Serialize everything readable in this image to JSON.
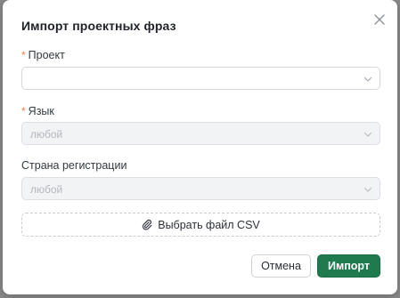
{
  "dialog": {
    "title": "Импорт проектных фраз",
    "close_icon": "close-icon"
  },
  "fields": {
    "project": {
      "label": "Проект",
      "required": true,
      "value": "",
      "icon": "chevron-down-icon"
    },
    "language": {
      "label": "Язык",
      "required": true,
      "value": "любой",
      "disabled": true,
      "icon": "chevron-down-icon"
    },
    "country": {
      "label": "Страна регистрации",
      "required": false,
      "value": "любой",
      "disabled": true,
      "icon": "chevron-down-icon"
    }
  },
  "file_upload": {
    "label": "Выбрать файл CSV",
    "icon": "paperclip-icon"
  },
  "actions": {
    "cancel_label": "Отмена",
    "import_label": "Импорт"
  },
  "colors": {
    "primary": "#1f7a4d",
    "required": "#f5813d",
    "overlay": "#8a8a8a"
  }
}
